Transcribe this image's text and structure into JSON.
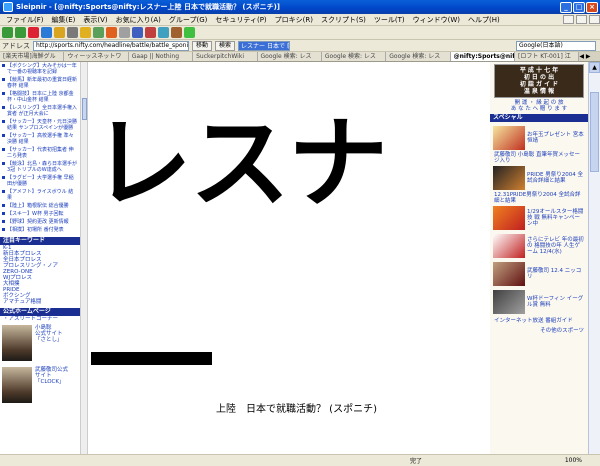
{
  "window": {
    "title": "Sleipnir - [@nifty:Sports@nifty:レスナー上陸 日本で就職活動？ (スポニチ)]",
    "min": "_",
    "max": "□",
    "close": "×"
  },
  "menu": [
    "ファイル(F)",
    "編集(E)",
    "表示(V)",
    "お気に入り(A)",
    "グループ(G)",
    "セキュリティ(P)",
    "プロキシ(R)",
    "スクリプト(S)",
    "ツール(T)",
    "ウィンドウ(W)",
    "ヘルプ(H)"
  ],
  "address": {
    "label": "アドレス",
    "url": "http://sports.nifty.com/headline/battle/battle_sponichi_2005010",
    "go": "移動",
    "search_label": "検索",
    "search_value": "レスナー 日本で 就職",
    "engine": "Google(日本語)"
  },
  "tabs": [
    "[楽天市場]海鮮グル",
    "ウィーッスネットワ",
    "Gaap || Nothing",
    "SuckerpitchWiki",
    "Google 検索: レス",
    "Google 検索: レス",
    "Google 検索: レス",
    "@nifty:Sports@nift",
    "[ロフト KT-001] 江"
  ],
  "headline": {
    "big": "レスナ",
    "caption": "上陸　日本で就職活動？ (スポニチ)"
  },
  "left": {
    "news": [
      "【ボクシング】大みそかは一年で一番の視聴率を記録",
      "【競馬】新年最初の重賞日経新春杯 結果",
      "【格闘技】日本に上陸 京都金杯・中山金杯 結果",
      "【レスリング】全日本選手権入賞者 が正月大会に",
      "【サッカー】天皇杯・元日決勝結果 サンプロスペインが優勝",
      "【サッカー】高校選手権 準々決勝 結果",
      "【サッカー】代表初招集者 伸二ら発表",
      "【競泳】北島・森ら日本選手が3冠 トリプルのW達成へ",
      "【ラグビー】大学選手権 早稲田が優勝",
      "【アメフト】ライスボウル 結果",
      "【陸上】箱根駅伝 総合優勝",
      "【スキー】W杯 男子回転",
      "【野球】契約更改 更新情報",
      "【相撲】初場所 番付発表"
    ],
    "keywords_header": "注目キーワード",
    "keywords": [
      "K-1",
      "新日本プロレス",
      "全日本プロレス",
      "プロレスリング・ノア",
      "ZERO-ONE",
      "WJプロレス",
      "大相撲",
      "PRIDE",
      "ボクシング",
      "アマチュア格闘"
    ],
    "official_header": "公式ホームページ",
    "official_link": "・アスリートコーナー",
    "profiles": [
      {
        "name": "小島聡",
        "link": "公式サイト",
        "sub": "「さとし」"
      },
      {
        "name": "武藤敬司公式",
        "link": "サイト",
        "sub": "「CLOCK」"
      }
    ]
  },
  "right": {
    "ad_top": "平 成 十 七 年\n初 日 の 出\n初 詣 ガ イ ド\n温 泉 情 報",
    "ad_top_link": "開 運 ・ 縁 起 の 旅\nあ な た へ 贈 り ま す",
    "special_header": "スペシャル",
    "items": [
      {
        "text": "お年玉プレゼント 宮本恒靖"
      },
      {
        "text": "武藤敬司 小島聡 直筆年賀メッセージ入り"
      },
      {
        "text": "PRIDE 男祭り2004 全試合詳細と結果"
      },
      {
        "text": "12.31PRIDE男祭り2004 全試合詳細と結果"
      },
      {
        "text": "1/29オールスター格闘技 戦 無料キャンペーン中"
      },
      {
        "text": "さらにテレビ 年の最初の 格闘技の年 人生ゲーム 12/4(水)"
      },
      {
        "text": "武藤敬司 12.4 ニッコリ"
      },
      {
        "text": "W杯ドーフィン イーグル賞 無料"
      },
      {
        "text": "インターネット放送 番組ガイド"
      }
    ],
    "more": "その他のスポーツ"
  },
  "status": {
    "text": "完了",
    "zoom": "100%"
  }
}
